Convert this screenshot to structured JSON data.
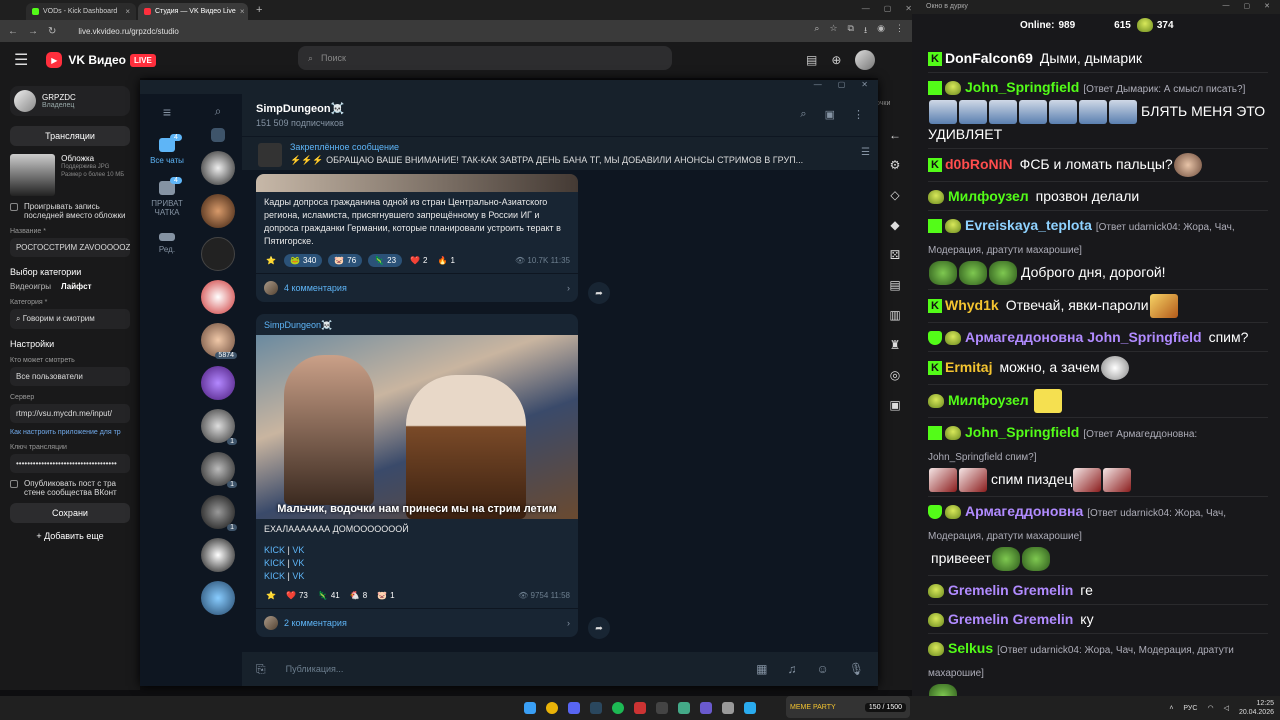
{
  "browser": {
    "tabs": [
      {
        "title": "VODs - Kick Dashboard",
        "color": "#53fc18"
      },
      {
        "title": "Студия — VK Видео Live",
        "color": "#ff2f3d"
      }
    ],
    "new_tab": "+",
    "url": "live.vkvideo.ru/grpzdc/studio"
  },
  "vk": {
    "logo_text": "VK Видео",
    "live_badge": "LIVE",
    "search_placeholder": "Поиск",
    "channel_name": "GRPZDC",
    "channel_role": "Владелец",
    "broadcasts_button": "Трансляции",
    "cover_title": "Обложка",
    "cover_desc": "Поддержива JPG Размер о более 10 МБ",
    "play_recording": "Проигрывать запись последней вместо обложки",
    "name_label": "Название *",
    "name_value": "РОСГОССТРИМ ZAVOOOOOZ",
    "category_section": "Выбор категории",
    "cat_games": "Видеоигры",
    "cat_life": "Лайфст",
    "category_label": "Категория *",
    "category_value": "Говорим и смотрим",
    "settings_title": "Настройки",
    "who_can_watch": "Кто может смотреть",
    "who_value": "Все пользователи",
    "server_label": "Сервер",
    "server_value": "rtmp://vsu.mycdn.me/input/",
    "howto_link": "Как настроить приложение для тр",
    "key_label": "Ключ трансляции",
    "key_value": "••••••••••••••••••••••••••••••••••••",
    "publish_post": "Опубликовать пост с тра стене сообщества ВКонт",
    "save_button": "Сохрани",
    "add_more": "Добавить еще",
    "right_partial": "очки"
  },
  "telegram": {
    "rail": [
      {
        "label": "Все чаты",
        "badge": "4",
        "active": true
      },
      {
        "label": "ПРИВАТ ЧАТКА",
        "badge": "4",
        "active": false
      },
      {
        "label": "Ред.",
        "badge": "",
        "active": false
      }
    ],
    "chat_counts": [
      "5874",
      "1",
      "1",
      "1"
    ],
    "channel_title": "SimpDungeon☠️",
    "subscribers": "151 509 подписчиков",
    "pinned_title": "Закреплённое сообщение",
    "pinned_text": "⚡️⚡️⚡️ ОБРАЩАЮ ВАШЕ ВНИМАНИЕ!  ТАК-КАК ЗАВТРА ДЕНЬ БАНА ТГ, МЫ ДОБАВИЛИ АНОНСЫ СТРИМОВ В ГРУП...",
    "post1": {
      "text": "Кадры допроса гражданина одной из стран Центрально-Азиатского региона, исламиста, присягнувшего запрещённому в России ИГ и допроса гражданки Германии, которые планировали устроить теракт в Пятигорске.",
      "reactions": [
        {
          "emoji": "⭐",
          "count": ""
        },
        {
          "emoji": "🐸",
          "count": "340"
        },
        {
          "emoji": "🐷",
          "count": "76"
        },
        {
          "emoji": "🦎",
          "count": "23"
        },
        {
          "emoji": "❤️",
          "count": "2"
        },
        {
          "emoji": "🔥",
          "count": "1"
        }
      ],
      "views": "10.7K",
      "time": "11:35",
      "comments": "4 комментария"
    },
    "post2": {
      "author": "SimpDungeon☠️",
      "caption": "Мальчик, водочки нам принеси  мы на стрим летим",
      "text": "ЕХАЛААААААА ДОМОООООООЙ",
      "links": [
        [
          "KICK",
          "VK"
        ],
        [
          "KICK",
          "VK"
        ],
        [
          "KICK",
          "VK"
        ]
      ],
      "reactions": [
        {
          "emoji": "⭐",
          "count": ""
        },
        {
          "emoji": "❤️",
          "count": "73"
        },
        {
          "emoji": "🦎",
          "count": "41"
        },
        {
          "emoji": "🐔",
          "count": "8"
        },
        {
          "emoji": "🐷",
          "count": "1"
        }
      ],
      "views": "9754",
      "time": "11:58",
      "comments": "2 комментария"
    },
    "input_placeholder": "Публикация..."
  },
  "chat": {
    "window_title": "Окно в дурку",
    "online_label": "Online:",
    "online_count": "989",
    "stat1": "615",
    "stat2": "374",
    "messages": [
      {
        "badges": [
          "k"
        ],
        "user": "DonFalcon69",
        "color": "#ffffff",
        "text": "Дыми, дымарик",
        "reply": "",
        "emotes_after": []
      },
      {
        "badges": [
          "sword",
          "sub"
        ],
        "user": "John_Springfield",
        "color": "#53fc18",
        "reply": "[Ответ Дымарик: А смысл писать?]",
        "text": "БЛЯТЬ МЕНЯ ЭТО УДИВЛЯЕТ",
        "emotes_before": [
          "face",
          "face",
          "face",
          "face",
          "face",
          "face",
          "face"
        ]
      },
      {
        "badges": [
          "k"
        ],
        "user": "d0bRoNiN",
        "color": "#ff4d4d",
        "text": "ФСБ и ломать пальцы?",
        "reply": "",
        "emotes_after": [
          "bald"
        ]
      },
      {
        "badges": [
          "sub"
        ],
        "user": "Милфоузел",
        "color": "#53fc18",
        "text": "прозвон делали",
        "reply": ""
      },
      {
        "badges": [
          "sword",
          "sub"
        ],
        "user": "Evreiskaya_teplota",
        "color": "#8fd2ff",
        "reply": "[Ответ udarnick04: Жора, Чач, Модерация, дратути махарошие]",
        "text": "Доброго дня, дорогой!",
        "emotes_before": [
          "frog",
          "frog",
          "frog"
        ]
      },
      {
        "badges": [
          "k"
        ],
        "user": "Whyd1k",
        "color": "#f4c430",
        "text": "Отвечай, явки-пароли",
        "reply": "",
        "emotes_after": [
          "meme"
        ]
      },
      {
        "badges": [
          "shield",
          "sub"
        ],
        "user": "Армагеддоновна",
        "color": "#b18bff",
        "mention": "John_Springfield",
        "text": "спим?",
        "reply": ""
      },
      {
        "badges": [
          "k"
        ],
        "user": "Ermitaj",
        "color": "#f4c430",
        "text": "можно, а зачем",
        "reply": "",
        "emotes_after": [
          "troll"
        ]
      },
      {
        "badges": [
          "sub"
        ],
        "user": "Милфоузел",
        "color": "#53fc18",
        "text": "",
        "reply": "",
        "emotes_after": [
          "yellow"
        ]
      },
      {
        "badges": [
          "sword",
          "sub"
        ],
        "user": "John_Springfield",
        "color": "#53fc18",
        "reply": "[Ответ Армагеддоновна: John_Springfield спим?]",
        "text": "спим пиздец",
        "emotes_before": [
          "red",
          "red"
        ],
        "emotes_after": [
          "red",
          "red"
        ]
      },
      {
        "badges": [
          "shield",
          "sub"
        ],
        "user": "Армагеддоновна",
        "color": "#b18bff",
        "reply": "[Ответ udarnick04: Жора, Чач, Модерация, дратути махарошие]",
        "text": "привееет",
        "emotes_after": [
          "frog",
          "frog"
        ]
      },
      {
        "badges": [
          "sub"
        ],
        "user": "Gremelin Gremelin",
        "color": "#b18bff",
        "text": "ге",
        "reply": ""
      },
      {
        "badges": [
          "sub"
        ],
        "user": "Gremelin Gremelin",
        "color": "#b18bff",
        "text": "ку",
        "reply": ""
      },
      {
        "badges": [
          "sub"
        ],
        "user": "Selkus",
        "color": "#53fc18",
        "reply": "[Ответ udarnick04: Жора, Чач, Модерация, дратути махарошие]",
        "text": "",
        "emotes_after": [
          "frog"
        ]
      }
    ]
  },
  "meme_widget": {
    "label": "MEME PARTY",
    "progress": "150 / 1500"
  },
  "tray": {
    "lang": "РУС",
    "time": "12:25",
    "date": "20.04.2026"
  }
}
